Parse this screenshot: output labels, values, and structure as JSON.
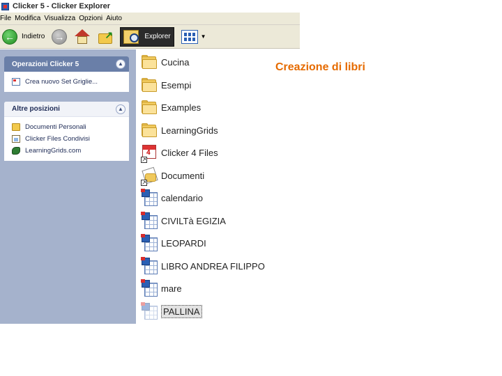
{
  "window": {
    "title": "Clicker 5 - Clicker Explorer"
  },
  "menu": [
    {
      "label": "File"
    },
    {
      "label": "Modifica"
    },
    {
      "label": "Visualizza"
    },
    {
      "label": "Opzioni"
    },
    {
      "label": "Aiuto"
    }
  ],
  "toolbar": {
    "back_label": "Indietro",
    "explorer_label": "Explorer",
    "icons": [
      "back-arrow-icon",
      "forward-arrow-icon",
      "home-icon",
      "folder-up-icon",
      "explorer-icon",
      "view-grid-icon"
    ]
  },
  "sidebar": {
    "tasks_title": "Operazioni Clicker 5",
    "tasks_items": [
      {
        "label": "Crea nuovo Set Griglie...",
        "icon": "new-grid-icon"
      }
    ],
    "places_title": "Altre posizioni",
    "places_items": [
      {
        "label": "Documenti Personali",
        "icon": "folder-icon"
      },
      {
        "label": "Clicker Files Condivisi",
        "icon": "shared-files-icon"
      },
      {
        "label": "LearningGrids.com",
        "icon": "web-icon"
      }
    ]
  },
  "files": [
    {
      "name": "Cucina",
      "type": "folder"
    },
    {
      "name": "Esempi",
      "type": "folder"
    },
    {
      "name": "Examples",
      "type": "folder"
    },
    {
      "name": "LearningGrids",
      "type": "folder"
    },
    {
      "name": "Clicker 4 Files",
      "type": "shortcut-clicker4"
    },
    {
      "name": "Documenti",
      "type": "shortcut-documents"
    },
    {
      "name": "calendario",
      "type": "grid-set"
    },
    {
      "name": "CIVILTà EGIZIA",
      "type": "grid-set"
    },
    {
      "name": "LEOPARDI",
      "type": "grid-set"
    },
    {
      "name": "LIBRO ANDREA FILIPPO",
      "type": "grid-set"
    },
    {
      "name": "mare",
      "type": "grid-set"
    },
    {
      "name": "PALLINA",
      "type": "grid-set",
      "selected": true
    }
  ],
  "caption": "Creazione di libri",
  "colors": {
    "sidebar_bg": "#a5b2cc",
    "panel_header": "#6a7fa8",
    "caption": "#e66b00"
  }
}
